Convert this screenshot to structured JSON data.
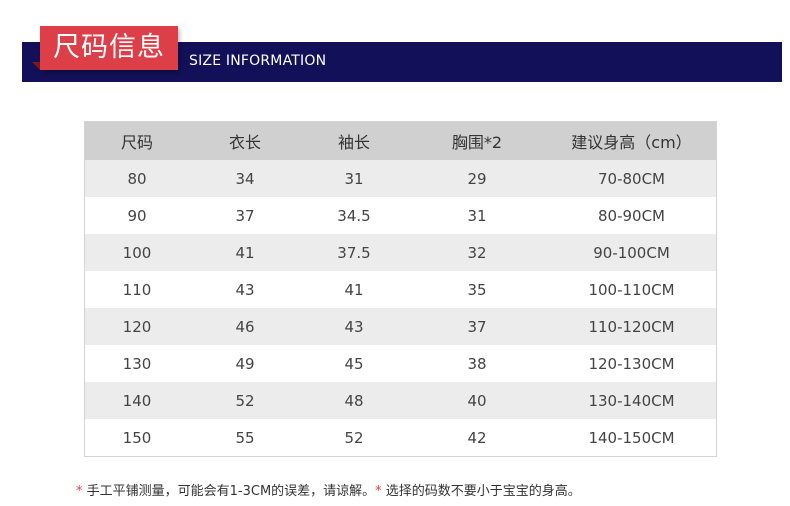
{
  "header": {
    "title_cn": "尺码信息",
    "title_en": "SIZE INFORMATION",
    "bar_color": "#121059",
    "tab_color": "#dd3f48"
  },
  "table": {
    "columns": [
      "尺码",
      "衣长",
      "袖长",
      "胸围*2",
      "建议身高（cm）"
    ],
    "rows": [
      [
        "80",
        "34",
        "31",
        "29",
        "70-80CM"
      ],
      [
        "90",
        "37",
        "34.5",
        "31",
        "80-90CM"
      ],
      [
        "100",
        "41",
        "37.5",
        "32",
        "90-100CM"
      ],
      [
        "110",
        "43",
        "41",
        "35",
        "100-110CM"
      ],
      [
        "120",
        "46",
        "43",
        "37",
        "110-120CM"
      ],
      [
        "130",
        "49",
        "45",
        "38",
        "120-130CM"
      ],
      [
        "140",
        "52",
        "48",
        "40",
        "130-140CM"
      ],
      [
        "150",
        "55",
        "52",
        "42",
        "140-150CM"
      ]
    ]
  },
  "note": {
    "star1": "*",
    "text1": " 手工平铺测量，可能会有1-3CM的误差，请谅解。",
    "star2": "*",
    "text2": " 选择的码数不要小于宝宝的身高。"
  }
}
